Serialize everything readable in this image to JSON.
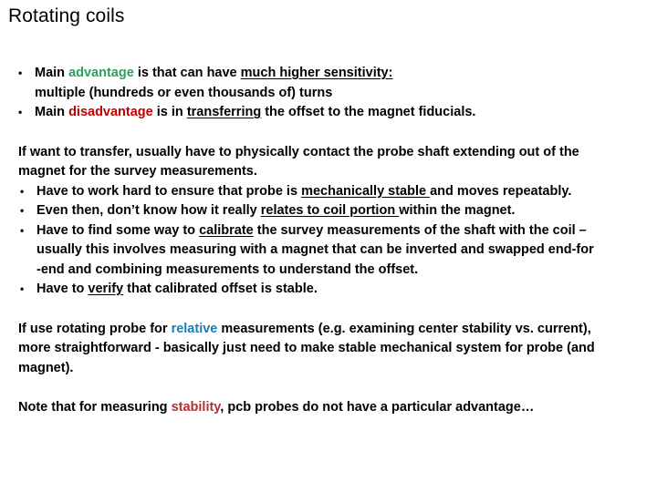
{
  "slide": {
    "title": "Rotating coils",
    "colors": {
      "advantage_green": "#2E9E62",
      "disadvantage_red": "#C00000",
      "relative_blue": "#1F7BB5",
      "stability_red": "#B43030",
      "text": "#000000",
      "background": "#FFFFFF"
    },
    "bullet_glyph": "•",
    "group1": {
      "b1_p1": "Main ",
      "b1_advantage": "advantage",
      "b1_p2": " is that can have ",
      "b1_underlined": "much higher sensitivity:",
      "b1_line2": "multiple (hundreds or even thousands of) turns",
      "b2_p1": "Main ",
      "b2_disadvantage": "disadvantage",
      "b2_p2": " is in ",
      "b2_underlined": "transferring",
      "b2_p3": " the offset to the magnet fiducials."
    },
    "group2": {
      "para_line1": "If want to transfer, usually have to physically contact the probe shaft extending out of the",
      "para_line2": "magnet for the survey measurements.",
      "b1_p1": "Have to work hard to ensure that probe is ",
      "b1_underlined": "mechanically stable ",
      "b1_p2": "and moves repeatably.",
      "b2_p1": "Even then, don’t know how it really ",
      "b2_underlined": "relates to coil portion ",
      "b2_p2": "within the magnet.",
      "b3_p1": "Have to find some way to ",
      "b3_underlined": "calibrate",
      "b3_p2": " the survey measurements of the shaft with the coil –",
      "b3_line2": "usually this involves measuring with a magnet that can be inverted and swapped end-for",
      "b3_line3": "-end and combining measurements to understand the offset.",
      "b4_p1": "Have to ",
      "b4_underlined": "verify",
      "b4_p2": " that calibrated offset is stable."
    },
    "group3": {
      "line1_p1": "If use rotating probe for ",
      "line1_relative": "relative",
      "line1_p2": " measurements (e.g. examining center stability vs. current),",
      "line2": "more straightforward - basically just need to make stable mechanical system for probe (and",
      "line3": "magnet)."
    },
    "group4": {
      "line1_p1": "Note that for measuring ",
      "line1_stability": "stability",
      "line1_p2": ", pcb probes do not have a particular advantage…"
    }
  }
}
